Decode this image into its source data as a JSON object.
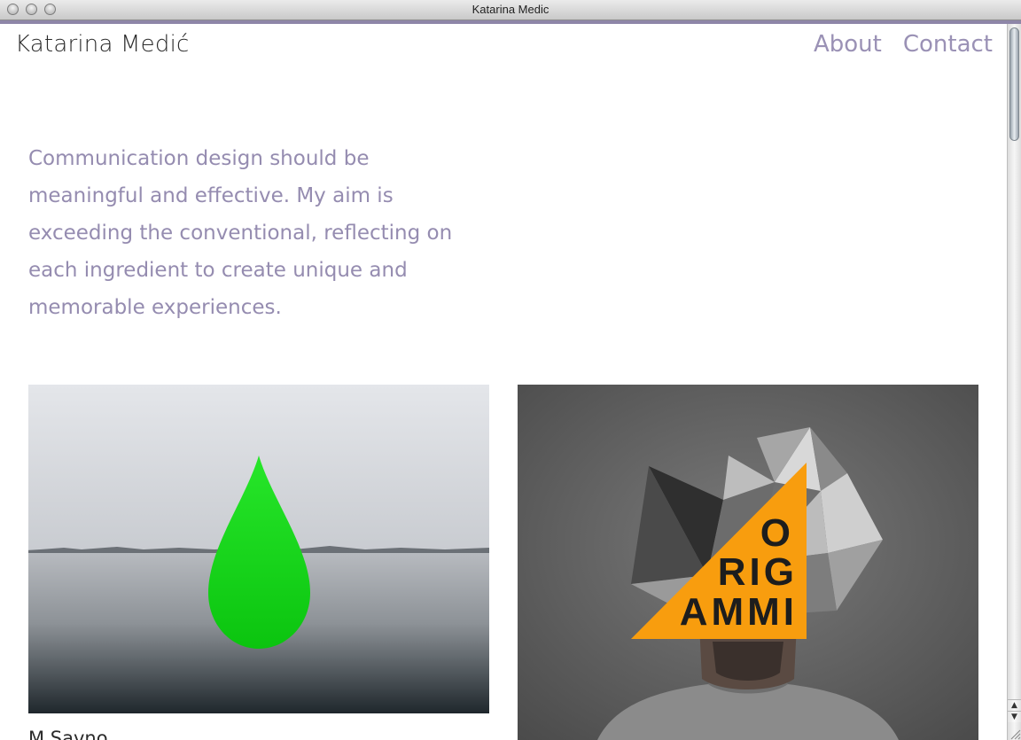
{
  "window": {
    "title": "Katarina Medic"
  },
  "header": {
    "brand": "Katarina Medić",
    "nav": [
      {
        "label": "About"
      },
      {
        "label": "Contact"
      }
    ]
  },
  "intro": {
    "text": "Communication design should be meaningful and effective. My aim is exceeding the conventional, reflecting on each ingredient to create unique and memorable experiences."
  },
  "projects": [
    {
      "caption": "M Savno"
    },
    {
      "caption": "",
      "artwork_text": [
        "O",
        "RIG",
        "AMMI"
      ]
    }
  ],
  "scrollbar": {
    "up_icon": "triangle-up-icon",
    "down_icon": "triangle-down-icon"
  },
  "colors": {
    "accent": "#958cb0",
    "nav": "#9a91b5",
    "drop_green": "#22dd22",
    "origami_orange": "#f89d0e",
    "window_strip": "#8e86a8"
  }
}
